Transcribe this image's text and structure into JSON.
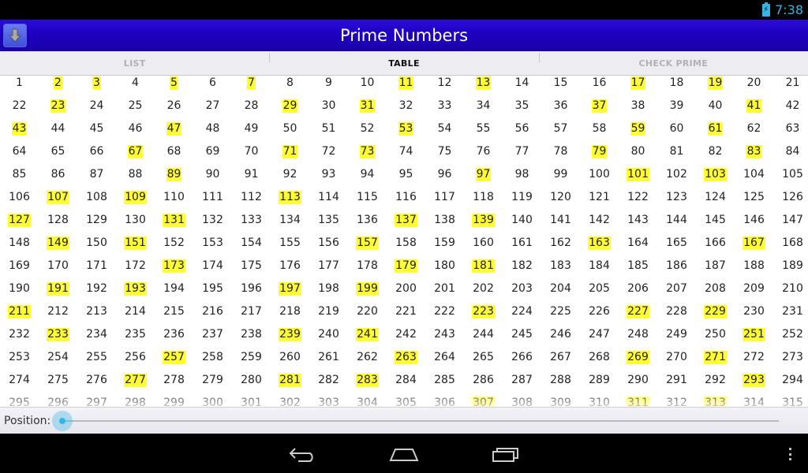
{
  "status": {
    "time": "7:38"
  },
  "app": {
    "title": "Prime Numbers",
    "icon": "download-arrow-icon"
  },
  "tabs": [
    {
      "label": "LIST",
      "active": false
    },
    {
      "label": "TABLE",
      "active": true
    },
    {
      "label": "CHECK PRIME",
      "active": false
    }
  ],
  "table": {
    "columns": 21,
    "start": 1,
    "end": 315,
    "highlight_color": "#ffff33"
  },
  "position": {
    "label": "Position:",
    "value": 0
  },
  "nav": {
    "back": "back-icon",
    "home": "home-icon",
    "recents": "recents-icon",
    "menu": "overflow-menu-icon"
  },
  "colors": {
    "appbar": "#1f00c0",
    "accent": "#33b5e5"
  }
}
